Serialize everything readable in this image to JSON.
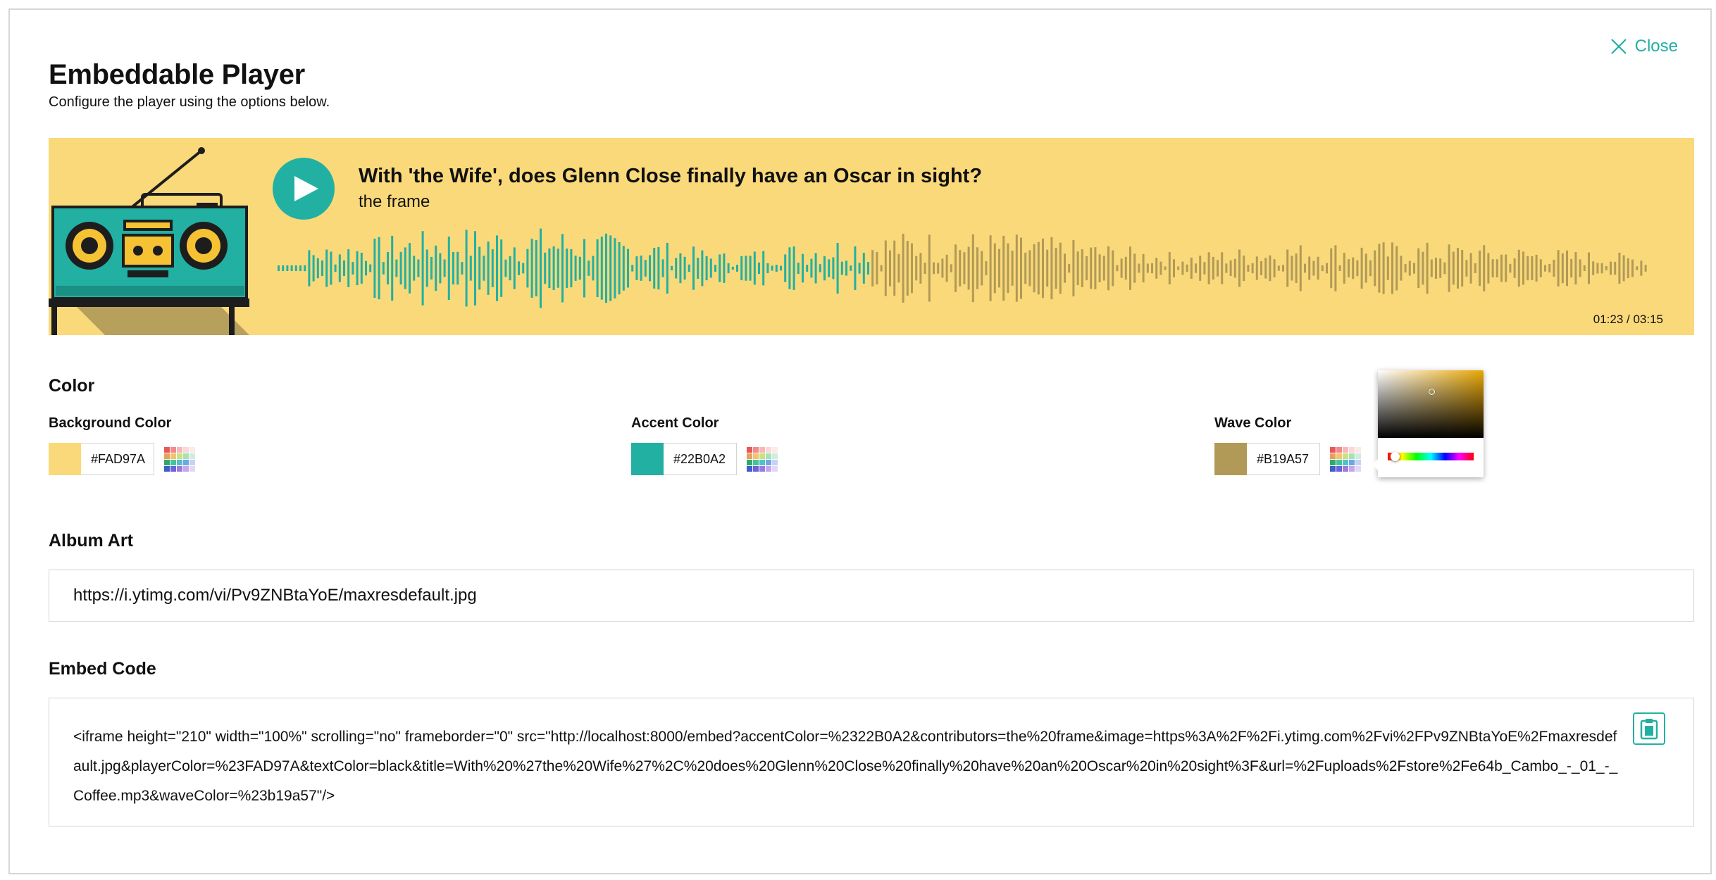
{
  "header": {
    "title": "Embeddable Player",
    "subtitle": "Configure the player using the options below.",
    "close_label": "Close"
  },
  "player": {
    "title": "With 'the Wife', does Glenn Close finally have an Oscar in sight?",
    "artist": "the frame",
    "time": "01:23 / 03:15",
    "progress": 0.43,
    "background_color": "#FAD97A",
    "accent_color": "#22B0A2",
    "wave_color": "#B19A57"
  },
  "color_section": {
    "heading": "Color",
    "background": {
      "label": "Background Color",
      "value": "#FAD97A",
      "swatch": "#FAD97A"
    },
    "accent": {
      "label": "Accent Color",
      "value": "#22B0A2",
      "swatch": "#22B0A2"
    },
    "wave": {
      "label": "Wave Color",
      "value": "#B19A57",
      "swatch": "#B19A57"
    }
  },
  "album_art": {
    "heading": "Album Art",
    "value": "https://i.ytimg.com/vi/Pv9ZNBtaYoE/maxresdefault.jpg"
  },
  "embed_code": {
    "heading": "Embed Code",
    "value": "<iframe height=\"210\" width=\"100%\" scrolling=\"no\" frameborder=\"0\" src=\"http://localhost:8000/embed?accentColor=%2322B0A2&contributors=the%20frame&image=https%3A%2F%2Fi.ytimg.com%2Fvi%2FPv9ZNBtaYoE%2Fmaxresdefault.jpg&playerColor=%23FAD97A&textColor=black&title=With%20%27the%20Wife%27%2C%20does%20Glenn%20Close%20finally%20have%20an%20Oscar%20in%20sight%3F&url=%2Fuploads%2Fstore%2Fe64b_Cambo_-_01_-_Coffee.mp3&waveColor=%23b19a57\"/>"
  },
  "icons": {
    "close": "close-icon",
    "play": "play-icon",
    "palette": "palette-icon",
    "clipboard": "clipboard-icon"
  }
}
